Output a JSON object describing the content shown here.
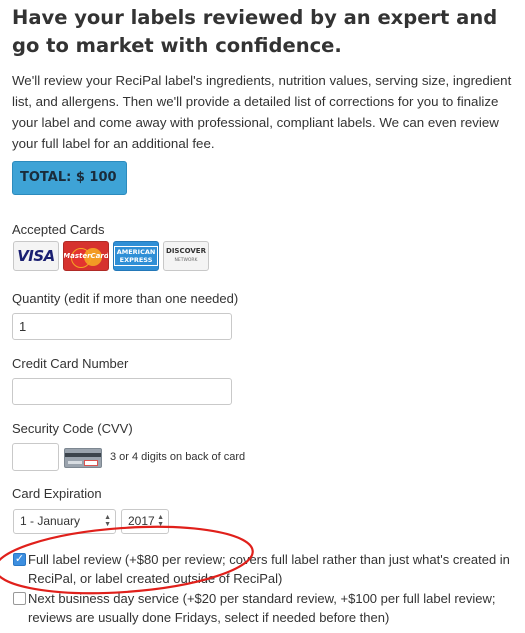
{
  "header": {
    "title": "Have your labels reviewed by an expert and go to market with confidence."
  },
  "intro": {
    "text": "We'll review your ReciPal label's ingredients, nutrition values, serving size, ingredient list, and allergens. Then we'll provide a detailed list of corrections for you to finalize your label and come away with professional, compliant labels. We can even review your full label for an additional fee."
  },
  "total": {
    "label": "TOTAL: $ 100"
  },
  "cards": {
    "label": "Accepted Cards",
    "items": [
      {
        "name": "VISA"
      },
      {
        "name": "MasterCard"
      },
      {
        "name": "AMERICAN EXPRESS",
        "line1": "AMERICAN",
        "line2": "EXPRESS"
      },
      {
        "name": "DISCOVER NETWORK",
        "line1": "DISCOVER",
        "line2": "NETWORK"
      }
    ]
  },
  "quantity": {
    "label": "Quantity (edit if more than one needed)",
    "value": "1"
  },
  "credit_card": {
    "label": "Credit Card Number",
    "value": ""
  },
  "security": {
    "label": "Security Code (CVV)",
    "value": "",
    "hint": "3 or 4 digits on back of card"
  },
  "expiration": {
    "label": "Card Expiration",
    "month": "1 - January",
    "year": "2017"
  },
  "options": {
    "full_review": {
      "checked": true,
      "text": "Full label review (+$80 per review; covers full label rather than just what's created in ReciPal, or label created outside of ReciPal)"
    },
    "next_day": {
      "checked": false,
      "text": "Next business day service (+$20 per standard review, +$100 per full label review; reviews are usually done Fridays, select if needed before then)"
    }
  },
  "colors": {
    "total_button": "#3ea3d6",
    "annotation_circle": "#e0201b",
    "checkbox_checked": "#3d8fe0"
  }
}
